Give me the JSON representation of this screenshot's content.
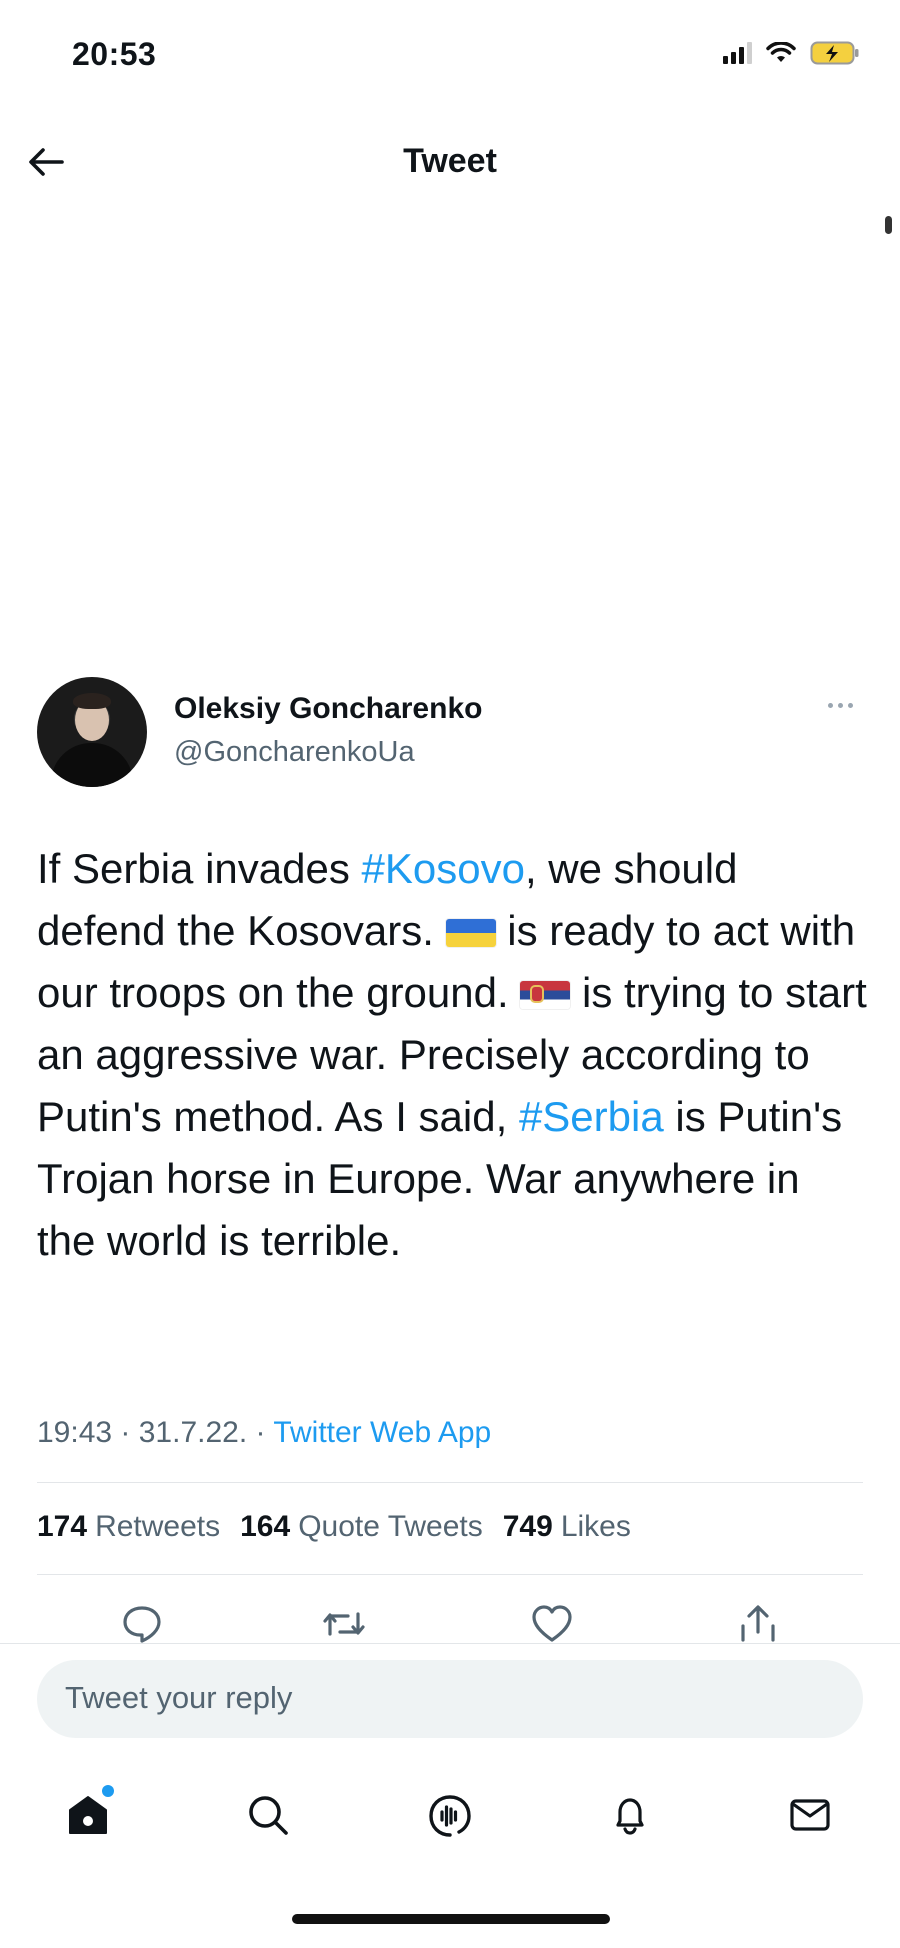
{
  "status_bar": {
    "time": "20:53"
  },
  "header": {
    "title": "Tweet"
  },
  "tweet": {
    "author": {
      "name": "Oleksiy Goncharenko",
      "handle": "@GoncharenkoUa"
    },
    "text": {
      "t1": "If Serbia invades ",
      "hashtag1": "#Kosovo",
      "t2": ", we should defend the Kosovars. ",
      "flag1": "Ukraine flag",
      "t3": " is ready to act with our troops on the ground. ",
      "flag2": "Serbia flag",
      "t4": " is trying to start an aggressive war. Precisely according to Putin's method. As I said, ",
      "hashtag2": "#Serbia",
      "t5": " is Putin's Trojan horse in Europe. War anywhere in the world is terrible."
    },
    "meta": {
      "time": "19:43",
      "sep": " · ",
      "date": "31.7.22.",
      "sep2": " · ",
      "source": "Twitter Web App"
    },
    "stats": {
      "retweets_count": "174",
      "retweets_label": "Retweets",
      "quotes_count": "164",
      "quotes_label": "Quote Tweets",
      "likes_count": "749",
      "likes_label": "Likes"
    }
  },
  "actions": [
    "reply-icon",
    "retweet-icon",
    "like-icon",
    "share-icon"
  ],
  "reply": {
    "placeholder": "Tweet your reply"
  },
  "tabbar": [
    "home-icon",
    "search-icon",
    "spaces-icon",
    "notifications-icon",
    "messages-icon"
  ],
  "colors": {
    "accent": "#1d9bf0",
    "secondary_text": "#536471",
    "primary_text": "#0f1419",
    "reply_bg": "#eff3f4"
  }
}
